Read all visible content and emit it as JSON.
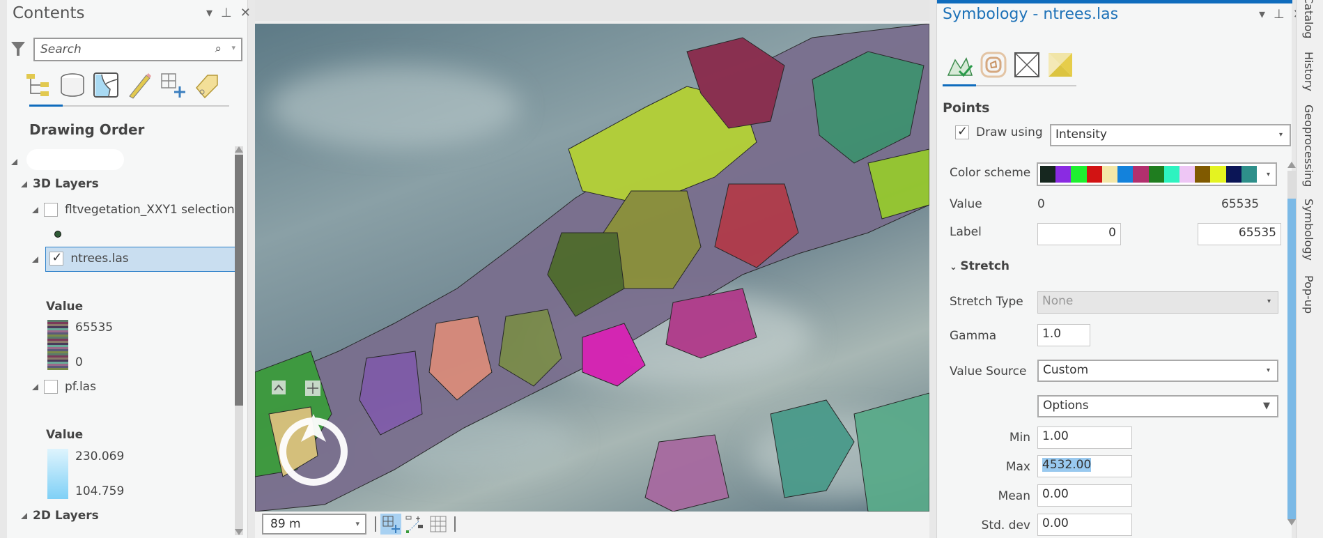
{
  "contents": {
    "title": "Contents",
    "search_placeholder": "Search",
    "toolbar_icons": [
      "list-by-drawing-order-icon",
      "list-by-data-source-icon",
      "list-by-selection-icon",
      "list-by-editing-icon",
      "list-by-snapping-icon",
      "list-by-labeling-icon"
    ],
    "section_title": "Drawing Order",
    "groups": {
      "layers3d": "3D Layers",
      "layers2d": "2D Layers"
    },
    "layers": [
      {
        "name": "fltvegetation_XXY1 selection",
        "checked": false
      },
      {
        "name": "ntrees.las",
        "checked": true,
        "selected": true,
        "legend_title": "Value",
        "legend_max": "65535",
        "legend_min": "0"
      },
      {
        "name": "pf.las",
        "checked": false,
        "legend_title": "Value",
        "legend_max": "230.069",
        "legend_min": "104.759"
      }
    ]
  },
  "map": {
    "scale": "89 m",
    "tools": [
      "explore-icon-active",
      "snapping-icon",
      "grid-icon"
    ]
  },
  "symbology": {
    "title": "Symbology - ntrees.las",
    "tabs": [
      "elevation-surface-icon",
      "contour-icon",
      "triangle-edges-icon",
      "face-icon"
    ],
    "section_points": "Points",
    "draw_using_label": "Draw using",
    "draw_using_checked": true,
    "draw_using_value": "Intensity",
    "color_scheme_label": "Color scheme",
    "color_scheme": [
      "#16271f",
      "#8a2be2",
      "#1ef030",
      "#d21313",
      "#f3e7a8",
      "#1382dc",
      "#b2306e",
      "#1f7d1f",
      "#2ef3c0",
      "#eec6f5",
      "#805a00",
      "#e4f321",
      "#0b1556",
      "#2e8f8a"
    ],
    "value_label": "Value",
    "value_min": "0",
    "value_max": "65535",
    "label_label": "Label",
    "label_min": "0",
    "label_max": "65535",
    "stretch_section": "Stretch",
    "stretch_type_label": "Stretch Type",
    "stretch_type_value": "None",
    "gamma_label": "Gamma",
    "gamma_value": "1.0",
    "value_source_label": "Value Source",
    "value_source_value": "Custom",
    "options_value": "Options",
    "min_label": "Min",
    "min_value": "1.00",
    "max_label": "Max",
    "max_value": "4532.00",
    "mean_label": "Mean",
    "mean_value": "0.00",
    "stddev_label": "Std. dev",
    "stddev_value": "0.00"
  },
  "side_tabs": [
    "Catalog",
    "History",
    "Geoprocessing",
    "Symbology",
    "Pop-up"
  ]
}
